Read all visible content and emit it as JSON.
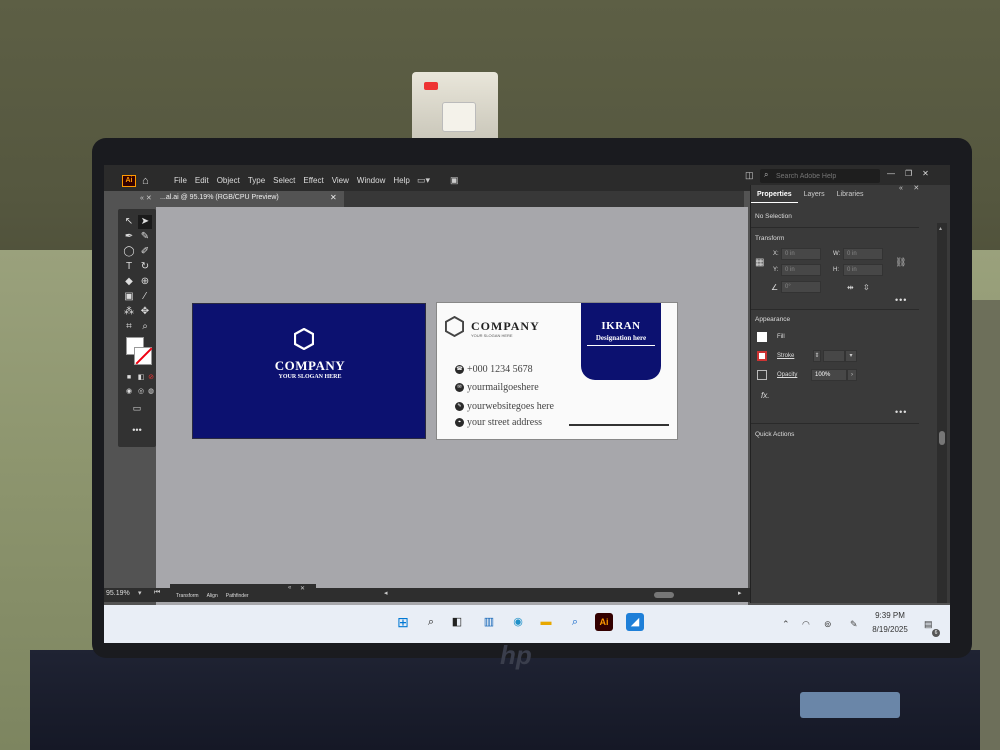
{
  "app": {
    "logo_text": "Ai",
    "menu": [
      "File",
      "Edit",
      "Object",
      "Type",
      "Select",
      "Effect",
      "View",
      "Window",
      "Help"
    ],
    "search_placeholder": "Search Adobe Help",
    "document_tab": "...al.ai @ 95.19% (RGB/CPU Preview)",
    "zoom": "95.19%"
  },
  "artwork": {
    "front": {
      "company": "COMPANY",
      "slogan": "YOUR SLOGAN HERE",
      "bg_color": "#0c1170"
    },
    "back": {
      "company": "COMPANY",
      "slogan": "YOUR SLOGAN HERE",
      "name": "IKRAN",
      "designation": "Designation here",
      "contacts": [
        {
          "icon": "phone-icon",
          "text": "+000 1234 5678"
        },
        {
          "icon": "mail-icon",
          "text": "yourmailgoeshere"
        },
        {
          "icon": "web-icon",
          "text": "yourwebsitegoes here"
        },
        {
          "icon": "location-icon",
          "text": "your street address"
        }
      ]
    }
  },
  "properties": {
    "tabs": [
      "Properties",
      "Layers",
      "Libraries"
    ],
    "selection": "No Selection",
    "transform_title": "Transform",
    "transform": {
      "x_label": "X:",
      "y_label": "Y:",
      "w_label": "W:",
      "h_label": "H:",
      "x": "0 in",
      "y": "0 in",
      "w": "0 in",
      "h": "0 in",
      "angle": "0°"
    },
    "appearance_title": "Appearance",
    "fill_label": "Fill",
    "stroke_label": "Stroke",
    "opacity_label": "Opacity",
    "opacity_value": "100%",
    "fx_label": "fx.",
    "quick_actions_title": "Quick Actions"
  },
  "bottom_panel": {
    "tabs": [
      "Transform",
      "Align",
      "Pathfinder"
    ]
  },
  "taskbar": {
    "time": "9:39 PM",
    "date": "8/19/2025",
    "notification_count": "6"
  }
}
